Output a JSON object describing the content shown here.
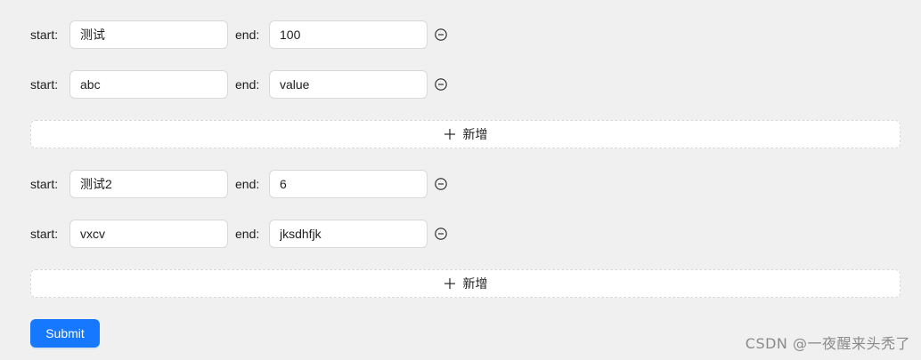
{
  "colors": {
    "primary": "#1677ff",
    "border": "#d9d9d9",
    "background": "#f0f0f0"
  },
  "icons": {
    "remove": "minus-circle-icon",
    "add": "plus-icon"
  },
  "groups": [
    {
      "rows": [
        {
          "start_label": "start:",
          "start_value": "测试",
          "end_label": "end:",
          "end_value": "100"
        },
        {
          "start_label": "start:",
          "start_value": "abc",
          "end_label": "end:",
          "end_value": "value"
        }
      ],
      "add_label": "新增"
    },
    {
      "rows": [
        {
          "start_label": "start:",
          "start_value": "测试2",
          "end_label": "end:",
          "end_value": "6"
        },
        {
          "start_label": "start:",
          "start_value": "vxcv",
          "end_label": "end:",
          "end_value": "jksdhfjk"
        }
      ],
      "add_label": "新增"
    }
  ],
  "submit_label": "Submit",
  "watermark": "CSDN @一夜醒来头秃了"
}
